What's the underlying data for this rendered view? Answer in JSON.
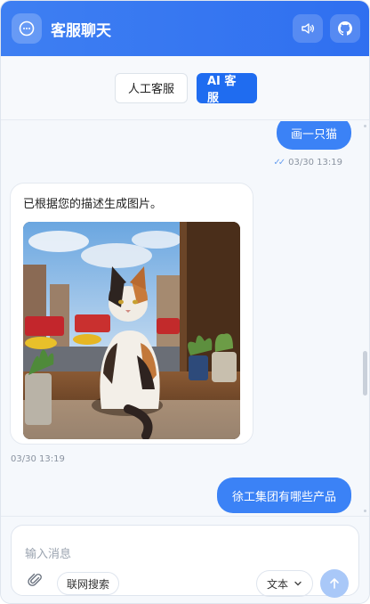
{
  "header": {
    "title": "客服聊天",
    "logo_icon": "chat-bubble-icon",
    "sound_icon": "speaker-icon",
    "github_icon": "github-icon",
    "accent": "#3b7ef3"
  },
  "mode_tabs": [
    {
      "label": "人工客服",
      "active": false
    },
    {
      "label": "AI 客服",
      "active": true
    }
  ],
  "messages": [
    {
      "role": "user",
      "text": "画一只猫",
      "time": "03/30 13:19",
      "status_icon": "double-check-icon"
    },
    {
      "role": "assistant",
      "text": "已根据您的描述生成图片。",
      "image": "cat-on-windowsill",
      "time": "03/30 13:19"
    },
    {
      "role": "user",
      "text": "徐工集团有哪些产品"
    }
  ],
  "composer": {
    "placeholder": "输入消息",
    "attach_icon": "paperclip-icon",
    "web_search_label": "联网搜索",
    "format_select": "文本",
    "send_icon": "arrow-up-icon"
  },
  "colors": {
    "primary": "#1f6cf0",
    "user_bubble": "#3b82f6",
    "send_disabled": "#a9c8f8"
  }
}
